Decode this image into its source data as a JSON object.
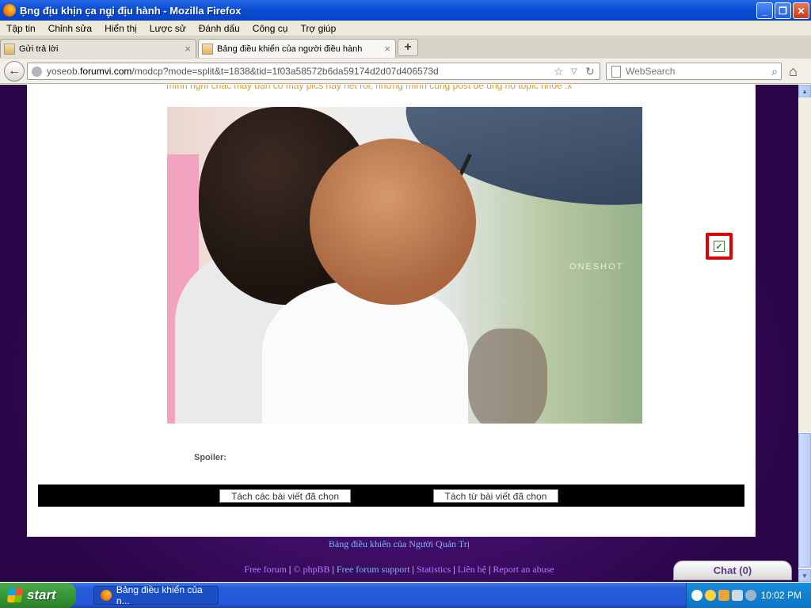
{
  "window": {
    "title": "Ḅng địu khịn c̣a ng̣̣i địu hành - Mozilla Firefox"
  },
  "menu": [
    "Tập tin",
    "Chỉnh sửa",
    "Hiển thị",
    "Lược sử",
    "Đánh dấu",
    "Công cụ",
    "Trợ giúp"
  ],
  "tabs": [
    {
      "label": "Gửi trả lời",
      "active": false
    },
    {
      "label": "Bảng điều khiển của người điều hành",
      "active": true
    }
  ],
  "nav": {
    "url_host": "yoseob.",
    "url_domain": "forumvi.com",
    "url_path": "/modcp?mode=split&t=1838&tid=1f03a58572b6da59174d2d07d406573d",
    "search_placeholder": "WebSearch"
  },
  "content": {
    "orange_text": "mình nghĩ chắc mấy bạn có mấy pics này hết rồi, nhưng mình cũng post để ủng hộ topic nhóe :x",
    "photo_watermark": "ONESHOT",
    "spoiler_label": "Spoiler:",
    "split_selected_button": "Tách các bài viết đã chọn",
    "split_from_button": "Tách từ bài viết đã chọn",
    "admin_panel_link": "Bảng điều khiển của Người Quản Trị",
    "footer": {
      "free_forum": "Free forum",
      "copyright": "©",
      "phpbb": "phpBB",
      "support": "Free forum support",
      "statistics": "Statistics",
      "contact": "Liên hệ",
      "abuse": "Report an abuse",
      "separator": "|"
    },
    "checkbox_checked": true,
    "chat_button": "Chat (0)"
  },
  "taskbar": {
    "start_label": "start",
    "task_label": "Bảng điều khiển của n...",
    "clock": "10:02 PM"
  },
  "colors": {
    "orange_text": "#e3982c",
    "footer_link_purple": "#b37bff",
    "footer_link_blue": "#7fb6ff",
    "highlight_red": "#e00000"
  }
}
